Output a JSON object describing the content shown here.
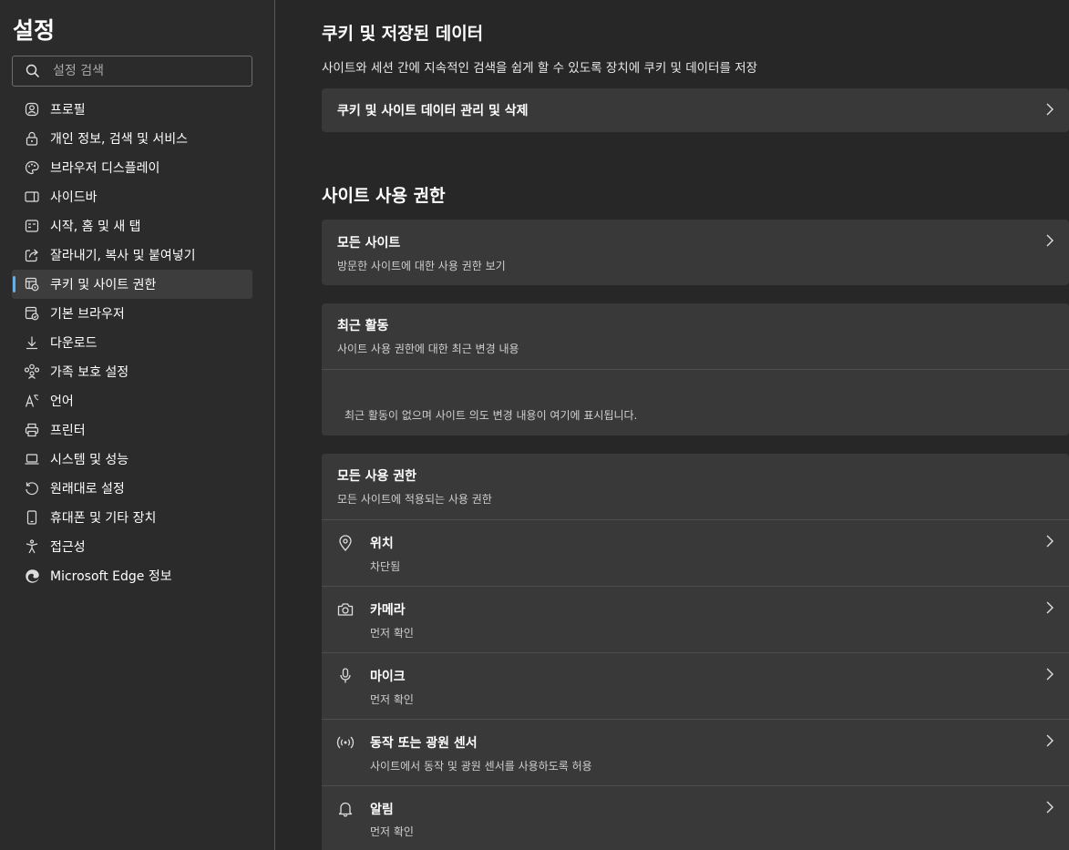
{
  "sidebar": {
    "title": "설정",
    "search_placeholder": "설정 검색",
    "items": [
      {
        "label": "프로필",
        "icon": "profile-icon"
      },
      {
        "label": "개인 정보, 검색 및 서비스",
        "icon": "lock-icon"
      },
      {
        "label": "브라우저 디스플레이",
        "icon": "palette-icon"
      },
      {
        "label": "사이드바",
        "icon": "sidebar-icon"
      },
      {
        "label": "시작, 홈 및 새 탭",
        "icon": "home-tab-icon"
      },
      {
        "label": "잘라내기, 복사 및 붙여넣기",
        "icon": "share-icon"
      },
      {
        "label": "쿠키 및 사이트 권한",
        "icon": "cookie-permissions-icon",
        "active": true
      },
      {
        "label": "기본 브라우저",
        "icon": "default-browser-icon"
      },
      {
        "label": "다운로드",
        "icon": "download-icon"
      },
      {
        "label": "가족 보호 설정",
        "icon": "family-icon"
      },
      {
        "label": "언어",
        "icon": "language-icon"
      },
      {
        "label": "프린터",
        "icon": "printer-icon"
      },
      {
        "label": "시스템 및 성능",
        "icon": "laptop-icon"
      },
      {
        "label": "원래대로 설정",
        "icon": "reset-icon"
      },
      {
        "label": "휴대폰 및 기타 장치",
        "icon": "phone-icon"
      },
      {
        "label": "접근성",
        "icon": "accessibility-icon"
      },
      {
        "label": "Microsoft Edge 정보",
        "icon": "edge-logo-icon"
      }
    ]
  },
  "cookies": {
    "heading": "쿠키 및 저장된 데이터",
    "description": "사이트와 세션 간에 지속적인 검색을 쉽게 할 수 있도록 장치에 쿠키 및 데이터를 저장",
    "manage_label": "쿠키 및 사이트 데이터 관리 및 삭제"
  },
  "site_permissions": {
    "heading": "사이트 사용 권한",
    "all_sites": {
      "title": "모든 사이트",
      "subtitle": "방문한 사이트에 대한 사용 권한 보기"
    },
    "recent": {
      "title": "최근 활동",
      "subtitle": "사이트 사용 권한에 대한 최근 변경 내용",
      "empty": "최근 활동이 없으며 사이트 의도 변경 내용이 여기에 표시됩니다."
    },
    "all_permissions": {
      "title": "모든 사용 권한",
      "subtitle": "모든 사이트에 적용되는 사용 권한",
      "items": [
        {
          "title": "위치",
          "subtitle": "차단됨",
          "icon": "location-pin-icon"
        },
        {
          "title": "카메라",
          "subtitle": "먼저 확인",
          "icon": "camera-icon"
        },
        {
          "title": "마이크",
          "subtitle": "먼저 확인",
          "icon": "microphone-icon"
        },
        {
          "title": "동작 또는 광원 센서",
          "subtitle": "사이트에서 동작 및 광원 센서를 사용하도록 허용",
          "icon": "sensor-icon"
        },
        {
          "title": "알림",
          "subtitle": "먼저 확인",
          "icon": "bell-icon"
        }
      ]
    }
  }
}
